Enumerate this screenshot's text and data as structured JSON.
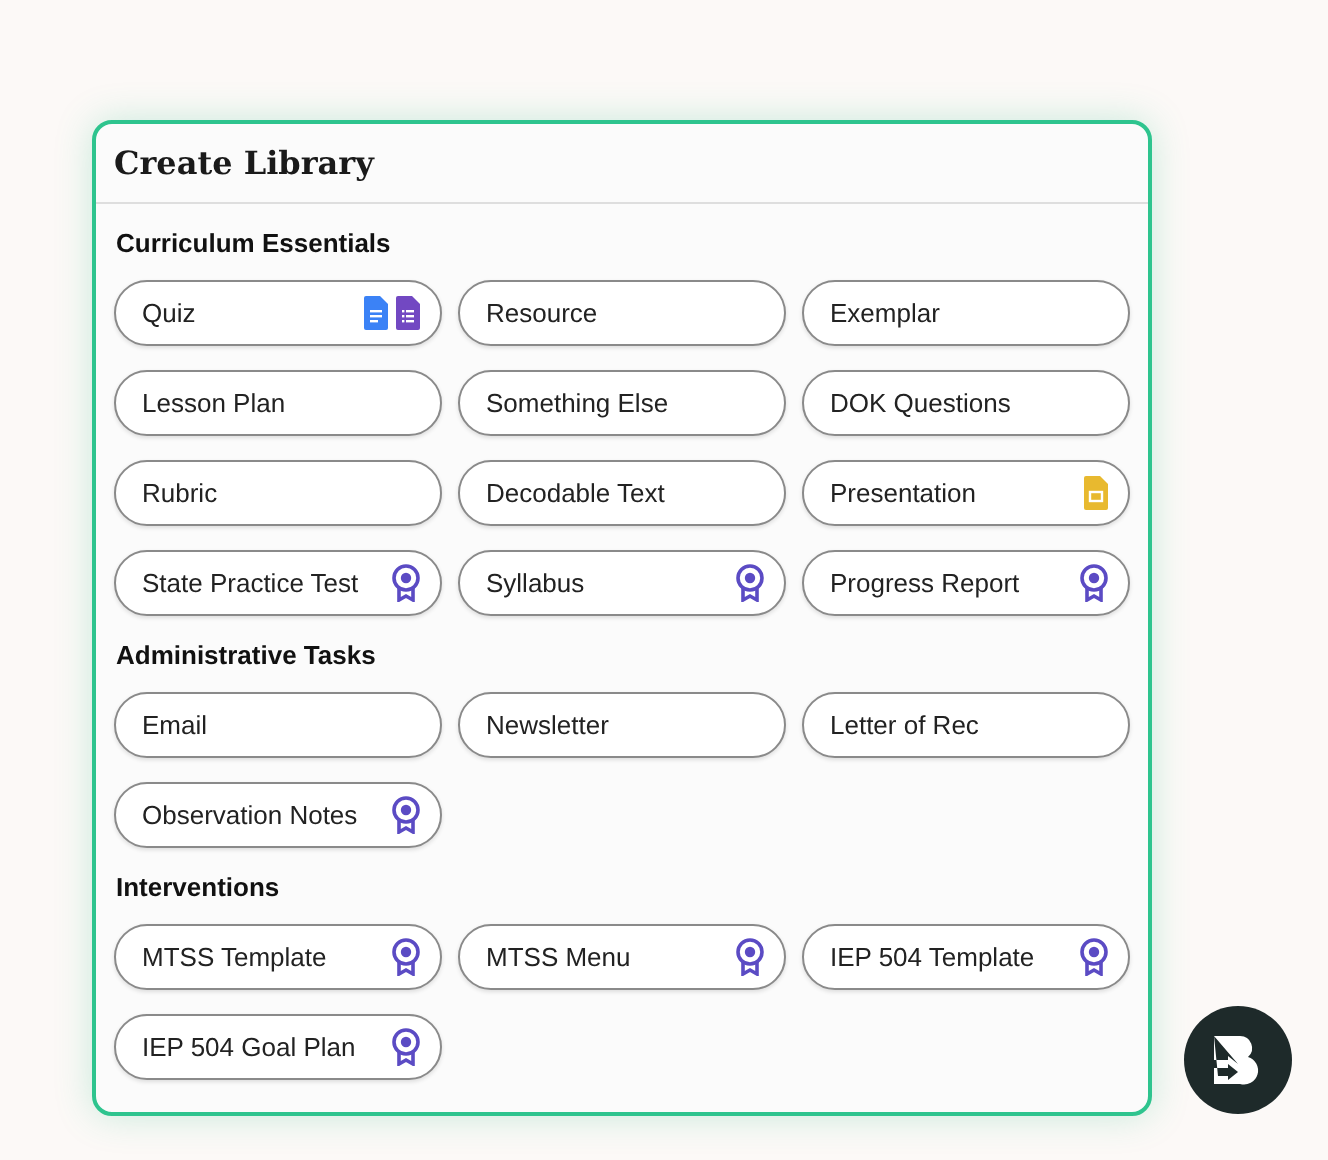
{
  "panel": {
    "title": "Create Library"
  },
  "sections": [
    {
      "title": "Curriculum Essentials",
      "items": [
        {
          "label": "Quiz",
          "kind": "docs"
        },
        {
          "label": "Resource",
          "kind": "plain"
        },
        {
          "label": "Exemplar",
          "kind": "plain"
        },
        {
          "label": "Lesson Plan",
          "kind": "plain"
        },
        {
          "label": "Something Else",
          "kind": "plain"
        },
        {
          "label": "DOK Questions",
          "kind": "plain"
        },
        {
          "label": "Rubric",
          "kind": "plain"
        },
        {
          "label": "Decodable Text",
          "kind": "plain"
        },
        {
          "label": "Presentation",
          "kind": "slides"
        },
        {
          "label": "State Practice Test",
          "kind": "award"
        },
        {
          "label": "Syllabus",
          "kind": "award"
        },
        {
          "label": "Progress Report",
          "kind": "award"
        }
      ]
    },
    {
      "title": "Administrative Tasks",
      "items": [
        {
          "label": "Email",
          "kind": "plain"
        },
        {
          "label": "Newsletter",
          "kind": "plain"
        },
        {
          "label": "Letter of Rec",
          "kind": "plain"
        },
        {
          "label": "Observation Notes",
          "kind": "award"
        }
      ]
    },
    {
      "title": "Interventions",
      "items": [
        {
          "label": "MTSS Template",
          "kind": "award"
        },
        {
          "label": "MTSS Menu",
          "kind": "award"
        },
        {
          "label": "IEP 504 Template",
          "kind": "award"
        },
        {
          "label": "IEP 504 Goal Plan",
          "kind": "award"
        }
      ]
    }
  ]
}
